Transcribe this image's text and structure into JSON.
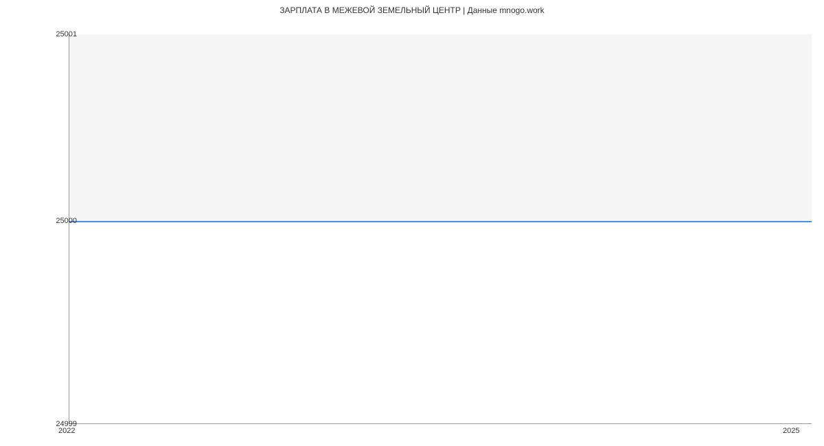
{
  "chart_data": {
    "type": "line",
    "title": "ЗАРПЛАТА В  МЕЖЕВОЙ ЗЕМЕЛЬНЫЙ ЦЕНТР | Данные mnogo.work",
    "x": [
      2022,
      2025
    ],
    "values": [
      25000,
      25000
    ],
    "xlabel": "",
    "ylabel": "",
    "xlim": [
      2022,
      2025
    ],
    "ylim": [
      24999,
      25001
    ],
    "x_ticks": [
      "2022",
      "2025"
    ],
    "y_ticks": [
      "24999",
      "25000",
      "25001"
    ]
  }
}
